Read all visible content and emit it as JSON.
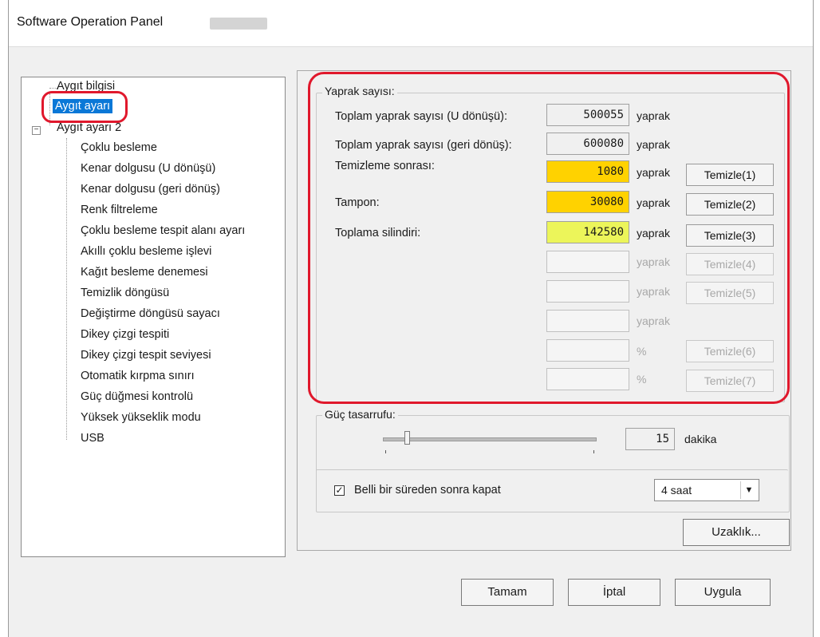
{
  "window": {
    "title": "Software Operation Panel"
  },
  "tree": {
    "items": [
      {
        "label": "Aygıt bilgisi"
      },
      {
        "label": "Aygıt ayarı"
      },
      {
        "label": "Aygıt ayarı 2"
      },
      {
        "label": "Çoklu besleme"
      },
      {
        "label": "Kenar dolgusu (U dönüşü)"
      },
      {
        "label": "Kenar dolgusu (geri dönüş)"
      },
      {
        "label": "Renk filtreleme"
      },
      {
        "label": "Çoklu besleme tespit alanı ayarı"
      },
      {
        "label": "Akıllı çoklu besleme işlevi"
      },
      {
        "label": "Kağıt besleme denemesi"
      },
      {
        "label": "Temizlik döngüsü"
      },
      {
        "label": "Değiştirme döngüsü sayacı"
      },
      {
        "label": "Dikey çizgi tespiti"
      },
      {
        "label": "Dikey çizgi tespit seviyesi"
      },
      {
        "label": "Otomatik kırpma sınırı"
      },
      {
        "label": "Güç düğmesi kontrolü"
      },
      {
        "label": "Yüksek yükseklik modu"
      },
      {
        "label": "USB"
      }
    ]
  },
  "sheet_count": {
    "group_label": "Yaprak sayısı:",
    "rows": [
      {
        "label": "Toplam yaprak sayısı (U dönüşü):",
        "value": "500055",
        "unit": "yaprak",
        "button": ""
      },
      {
        "label": "Toplam yaprak sayısı (geri dönüş):",
        "value": "600080",
        "unit": "yaprak",
        "button": ""
      },
      {
        "label": "Temizleme sonrası:",
        "value": "1080",
        "unit": "yaprak",
        "button": "Temizle(1)"
      },
      {
        "label": "Tampon:",
        "value": "30080",
        "unit": "yaprak",
        "button": "Temizle(2)"
      },
      {
        "label": "Toplama silindiri:",
        "value": "142580",
        "unit": "yaprak",
        "button": "Temizle(3)"
      },
      {
        "label": "",
        "value": "",
        "unit": "yaprak",
        "button": "Temizle(4)"
      },
      {
        "label": "",
        "value": "",
        "unit": "yaprak",
        "button": "Temizle(5)"
      },
      {
        "label": "",
        "value": "",
        "unit": "yaprak",
        "button": ""
      },
      {
        "label": "",
        "value": "",
        "unit": "%",
        "button": "Temizle(6)"
      },
      {
        "label": "",
        "value": "",
        "unit": "%",
        "button": "Temizle(7)"
      }
    ]
  },
  "power_save": {
    "group_label": "Güç tasarrufu:",
    "slider_fraction": 0.1,
    "value": "15",
    "unit": "dakika",
    "checkbox_label": "Belli bir süreden sonra kapat",
    "checkbox_mark": "✓",
    "checked": true,
    "select_value": "4 saat",
    "select_arrow": "▼"
  },
  "remote_button": "Uzaklık...",
  "footer": {
    "ok": "Tamam",
    "cancel": "İptal",
    "apply": "Uygula"
  },
  "highlight_color": "#e0182c"
}
